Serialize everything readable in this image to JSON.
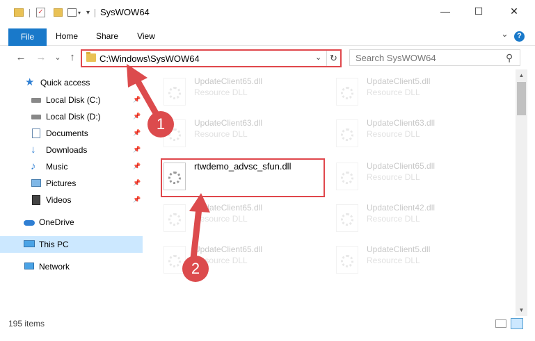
{
  "window": {
    "title": "SysWOW64",
    "minimize": "—",
    "maximize": "☐",
    "close": "✕"
  },
  "ribbon": {
    "tabs": [
      "File",
      "Home",
      "Share",
      "View"
    ],
    "expand": "⌄",
    "help": "?"
  },
  "address": {
    "path": "C:\\Windows\\SysWOW64",
    "dropdown": "⌄",
    "refresh": "↻"
  },
  "search": {
    "placeholder": "Search SysWOW64",
    "icon": "⚲"
  },
  "nav": {
    "back": "←",
    "forward": "→",
    "recent": "⌄",
    "up": "↑",
    "items": [
      {
        "label": "Quick access",
        "icon": "star-icon",
        "pinned": false
      },
      {
        "label": "Local Disk (C:)",
        "icon": "drive-icon",
        "pinned": true
      },
      {
        "label": "Local Disk (D:)",
        "icon": "drive-icon",
        "pinned": true
      },
      {
        "label": "Documents",
        "icon": "documents-icon",
        "pinned": true
      },
      {
        "label": "Downloads",
        "icon": "download-icon",
        "pinned": true
      },
      {
        "label": "Music",
        "icon": "music-icon",
        "pinned": true
      },
      {
        "label": "Pictures",
        "icon": "pictures-icon",
        "pinned": true
      },
      {
        "label": "Videos",
        "icon": "video-icon",
        "pinned": true
      },
      {
        "label": "OneDrive",
        "icon": "cloud-icon",
        "pinned": false
      },
      {
        "label": "This PC",
        "icon": "computer-icon",
        "pinned": false,
        "selected": true
      },
      {
        "label": "Network",
        "icon": "network-icon",
        "pinned": false
      }
    ]
  },
  "files": [
    {
      "name": "UpdateClient65.dll",
      "desc": "Resource DLL",
      "faded": true
    },
    {
      "name": "UpdateClient5.dll",
      "desc": "Resource DLL",
      "faded": true
    },
    {
      "name": "UpdateClient63.dll",
      "desc": "Resource DLL",
      "faded": true
    },
    {
      "name": "UpdateClient63.dll",
      "desc": "Resource DLL",
      "faded": true
    },
    {
      "name": "rtwdemo_advsc_sfun.dll",
      "desc": "",
      "faded": false,
      "highlighted": true
    },
    {
      "name": "UpdateClient65.dll",
      "desc": "Resource DLL",
      "faded": true
    },
    {
      "name": "UpdateClient65.dll",
      "desc": "Resource DLL",
      "faded": true
    },
    {
      "name": "UpdateClient42.dll",
      "desc": "Resource DLL",
      "faded": true
    },
    {
      "name": "UpdateClient65.dll",
      "desc": "Resource DLL",
      "faded": true
    },
    {
      "name": "UpdateClient5.dll",
      "desc": "Resource DLL",
      "faded": true
    }
  ],
  "status": {
    "items": "195 items"
  },
  "annotations": {
    "badge1": "1",
    "badge2": "2",
    "color": "#dc4b4d"
  }
}
